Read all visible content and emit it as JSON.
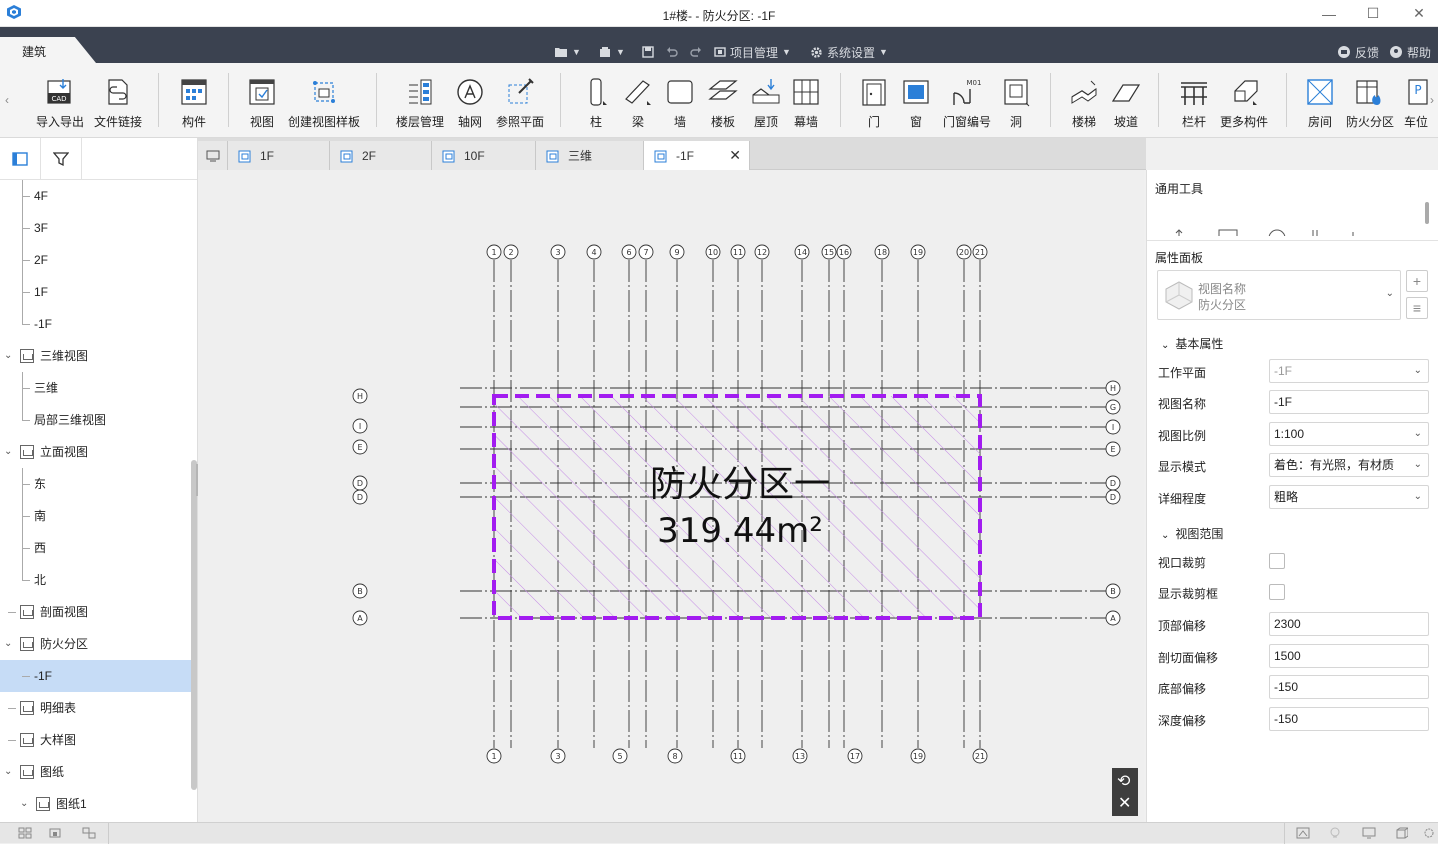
{
  "window": {
    "title": "1#楼- - 防火分区: -1F",
    "minimize": "—",
    "maximize": "☐",
    "close": "✕"
  },
  "ribbon_tabs": {
    "active": "建筑",
    "project_mgmt": "项目管理",
    "system_settings": "系统设置",
    "feedback": "反馈",
    "help": "帮助"
  },
  "ribbon": {
    "import_export": "导入导出",
    "file_link": "文件链接",
    "component": "构件",
    "view": "视图",
    "create_view_template": "创建视图样板",
    "floor_mgmt": "楼层管理",
    "axis_grid": "轴网",
    "ref_plane": "参照平面",
    "column": "柱",
    "beam": "梁",
    "wall": "墙",
    "slab": "楼板",
    "roof": "屋顶",
    "curtain_wall": "幕墙",
    "door": "门",
    "window": "窗",
    "door_window_no": "门窗编号",
    "opening": "洞",
    "stair": "楼梯",
    "ramp": "坡道",
    "railing": "栏杆",
    "more_components": "更多构件",
    "room": "房间",
    "fire_zone": "防火分区",
    "vehicle": "车位",
    "cad_badge": "CAD",
    "m01_badge": "M01",
    "p_badge": "P"
  },
  "tree": {
    "items": [
      {
        "label": "4F"
      },
      {
        "label": "3F"
      },
      {
        "label": "2F"
      },
      {
        "label": "1F"
      },
      {
        "label": "-1F"
      },
      {
        "label": "三维视图"
      },
      {
        "label": "三维"
      },
      {
        "label": "局部三维视图"
      },
      {
        "label": "立面视图"
      },
      {
        "label": "东"
      },
      {
        "label": "南"
      },
      {
        "label": "西"
      },
      {
        "label": "北"
      },
      {
        "label": "剖面视图"
      },
      {
        "label": "防火分区"
      },
      {
        "label": "-1F"
      },
      {
        "label": "明细表"
      },
      {
        "label": "大样图"
      },
      {
        "label": "图纸"
      },
      {
        "label": "图纸1"
      }
    ]
  },
  "doc_tabs": [
    {
      "label": "1F"
    },
    {
      "label": "2F"
    },
    {
      "label": "10F"
    },
    {
      "label": "三维"
    },
    {
      "label": "-1F"
    }
  ],
  "drawing": {
    "zone_name": "防火分区一",
    "zone_area": "319.44m²",
    "top_axes": [
      "1",
      "2",
      "3",
      "4",
      "6",
      "7",
      "9",
      "10",
      "11",
      "12",
      "14",
      "15",
      "16",
      "18",
      "19",
      "20",
      "21"
    ],
    "bottom_axes": [
      "1",
      "3",
      "5",
      "8",
      "11",
      "13",
      "17",
      "19",
      "21"
    ],
    "left_axes": [
      "H",
      "I",
      "E",
      "D",
      "D",
      "B",
      "A"
    ],
    "right_axes": [
      "H",
      "G",
      "I",
      "E",
      "D",
      "D",
      "B",
      "A"
    ],
    "zone_color": "#a21cf0"
  },
  "right_panel": {
    "general_tools": "通用工具",
    "props_panel": "属性面板",
    "view_name_label": "视图名称",
    "view_name_value": "防火分区",
    "basic_props": "基本属性",
    "view_range": "视图范围",
    "props": {
      "work_plane": {
        "label": "工作平面",
        "value": "-1F"
      },
      "view_name": {
        "label": "视图名称",
        "value": "-1F"
      },
      "view_scale": {
        "label": "视图比例",
        "value": "1:100"
      },
      "display_mode": {
        "label": "显示模式",
        "value": "着色：有光照，有材质"
      },
      "detail_level": {
        "label": "详细程度",
        "value": "粗略"
      },
      "viewport_crop": {
        "label": "视口裁剪"
      },
      "show_crop_box": {
        "label": "显示裁剪框"
      },
      "top_offset": {
        "label": "顶部偏移",
        "value": "2300"
      },
      "cut_offset": {
        "label": "剖切面偏移",
        "value": "1500"
      },
      "bottom_offset": {
        "label": "底部偏移",
        "value": "-150"
      },
      "depth_offset": {
        "label": "深度偏移",
        "value": "-150"
      }
    }
  }
}
